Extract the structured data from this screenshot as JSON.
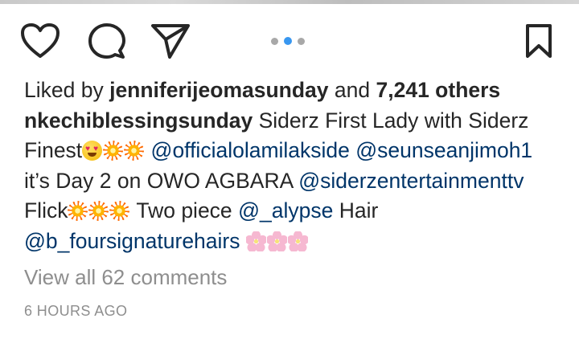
{
  "post": {
    "likes": {
      "prefix": "Liked by",
      "user": "jenniferijeomasunday",
      "connector": "and",
      "others": "7,241 others"
    },
    "caption": {
      "author": "nkechiblessingsunday",
      "t1": "Siderz First Lady with Siderz Finest",
      "m1": "@officialolamilakside",
      "m2": "@seunseanjimoh1",
      "t2": "it’s Day 2 on OWO AGBARA",
      "m3": "@siderzentertainmenttv",
      "t3": "Flick",
      "t4": "Two piece",
      "m4": "@_alypse",
      "t5": "Hair",
      "m5": "@b_foursignaturehairs"
    },
    "view_all_comments": "View all 62 comments",
    "timestamp": "6 HOURS AGO",
    "carousel": {
      "count": 3,
      "active_index": 1
    }
  },
  "icons": {
    "like": "heart-icon",
    "comment": "comment-bubble-icon",
    "share": "paper-plane-icon",
    "save": "bookmark-icon"
  },
  "colors": {
    "text": "#262626",
    "mention": "#003569",
    "muted": "#8e8e8e",
    "dot_active": "#3897f0",
    "dot_inactive": "#a8a8a8"
  }
}
